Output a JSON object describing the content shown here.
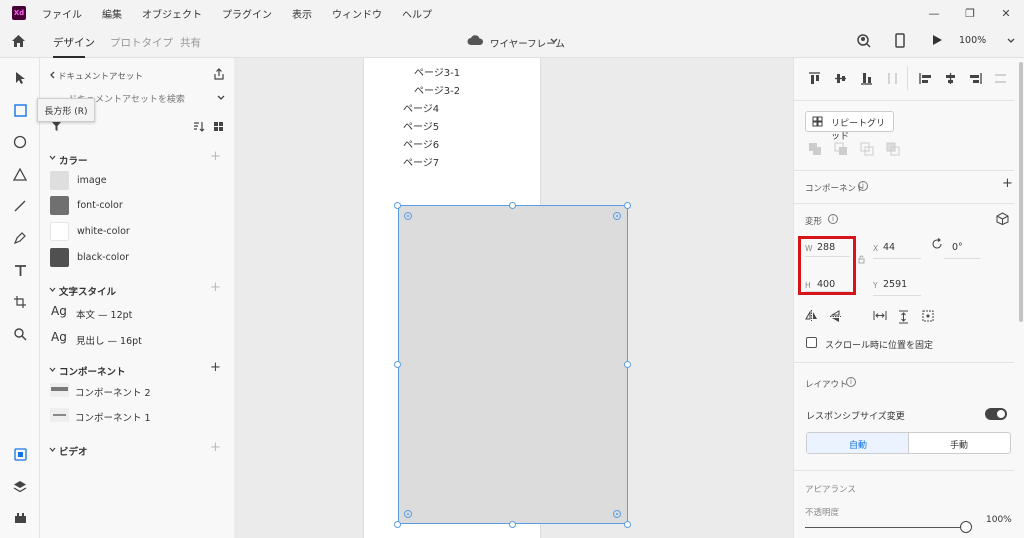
{
  "app_logo": "Xd",
  "menu": [
    "ファイル",
    "編集",
    "オブジェクト",
    "プラグイン",
    "表示",
    "ウィンドウ",
    "ヘルプ"
  ],
  "window_controls": {
    "minimize": "—",
    "restore": "❐",
    "close": "✕"
  },
  "tabs": {
    "design": "デザイン",
    "prototype": "プロトタイプ",
    "share": "共有"
  },
  "document_title": "ワイヤーフレーム",
  "zoom": "100%",
  "tooltip": "長方形 (R)",
  "assets": {
    "header": "ドキュメントアセット",
    "search_placeholder": "ドキュメントアセットを検索",
    "colors_title": "カラー",
    "colors": [
      {
        "label": "image",
        "hex": "#dedede"
      },
      {
        "label": "font-color",
        "hex": "#707070"
      },
      {
        "label": "white-color",
        "hex": "#ffffff"
      },
      {
        "label": "black-color",
        "hex": "#505050"
      }
    ],
    "char_styles_title": "文字スタイル",
    "char_styles": [
      {
        "glyph": "Ag",
        "label": "本文 — 12pt"
      },
      {
        "glyph": "Ag",
        "label": "見出し — 16pt"
      }
    ],
    "components_title": "コンポーネント",
    "components": [
      "コンポーネント 2",
      "コンポーネント 1"
    ],
    "video_title": "ビデオ"
  },
  "artboard_list": [
    "ページ3-1",
    "ページ3-2",
    "ページ4",
    "ページ5",
    "ページ6",
    "ページ7"
  ],
  "props": {
    "repeat_grid": "リピートグリッド",
    "component_label": "コンポーネント",
    "transform_label": "変形",
    "w_label": "W",
    "w_value": "288",
    "h_label": "H",
    "h_value": "400",
    "x_label": "X",
    "x_value": "44",
    "y_label": "Y",
    "y_value": "2591",
    "rotation": "0°",
    "fix_scroll": "スクロール時に位置を固定",
    "layout_label": "レイアウト",
    "responsive_label": "レスポンシブサイズ変更",
    "auto": "自動",
    "manual": "手動",
    "appearance_label": "アピアランス",
    "opacity_label": "不透明度",
    "opacity_value": "100%"
  },
  "colors": {
    "selection": "#5b9fe3",
    "highlight": "#d7141a"
  }
}
